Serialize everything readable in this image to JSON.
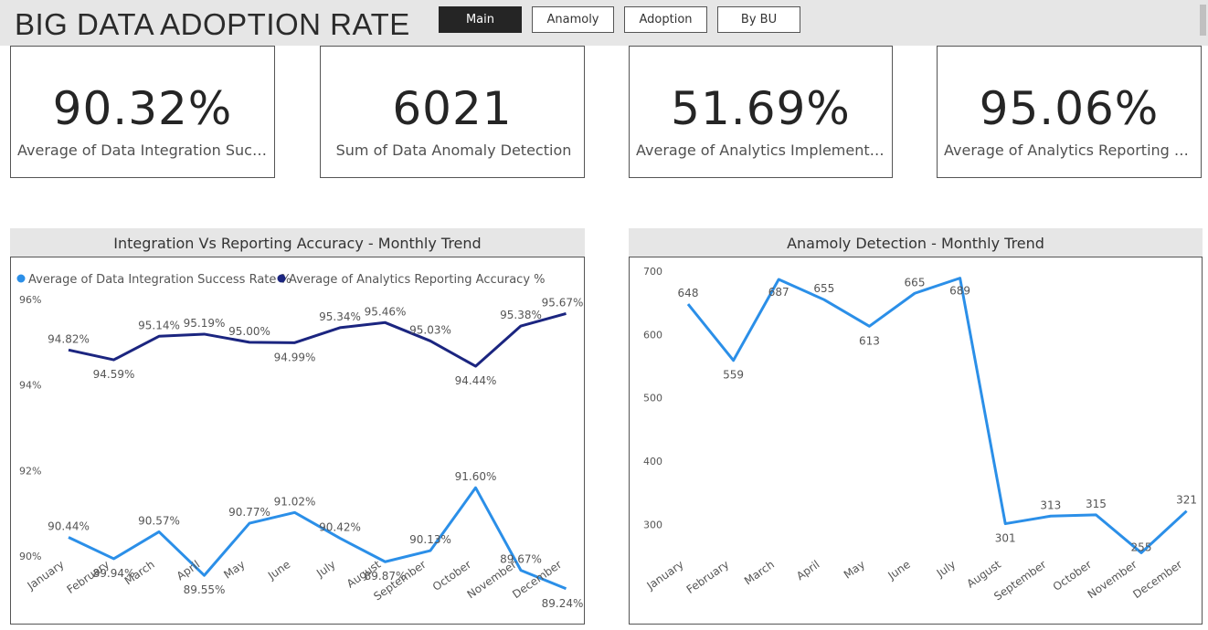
{
  "header": {
    "title": "BIG DATA ADOPTION RATE",
    "nav": [
      {
        "label": "Main",
        "active": true
      },
      {
        "label": "Anamoly",
        "active": false
      },
      {
        "label": "Adoption",
        "active": false
      },
      {
        "label": "By BU",
        "active": false
      }
    ]
  },
  "kpis": [
    {
      "value": "90.32%",
      "label": "Average of Data Integration Success..."
    },
    {
      "value": "6021",
      "label": "Sum of Data Anomaly Detection"
    },
    {
      "value": "51.69%",
      "label": "Average of Analytics Implementatio..."
    },
    {
      "value": "95.06%",
      "label": "Average of Analytics Reporting Accu..."
    }
  ],
  "colors": {
    "light_series": "#2b8fe8",
    "dark_series": "#1b2580",
    "anomaly_line": "#2b8fe8"
  },
  "chart_data": [
    {
      "type": "line",
      "title": "Integration Vs Reporting Accuracy - Monthly Trend",
      "categories": [
        "January",
        "February",
        "March",
        "April",
        "May",
        "June",
        "July",
        "August",
        "September",
        "October",
        "November",
        "December"
      ],
      "series": [
        {
          "name": "Average of Data Integration Success Rate %",
          "values": [
            90.44,
            89.94,
            90.57,
            89.55,
            90.77,
            91.02,
            90.42,
            89.87,
            90.13,
            91.6,
            89.67,
            89.24
          ],
          "labels": [
            "90.44%",
            "89.94%",
            "90.57%",
            "89.55%",
            "90.77%",
            "91.02%",
            "90.42%",
            "89.87%",
            "90.13%",
            "91.60%",
            "89.67%",
            "89.24%"
          ]
        },
        {
          "name": "Average of Analytics Reporting Accuracy %",
          "values": [
            94.82,
            94.59,
            95.14,
            95.19,
            95.0,
            94.99,
            95.34,
            95.46,
            95.03,
            94.44,
            95.38,
            95.67
          ],
          "labels": [
            "94.82%",
            "94.59%",
            "95.14%",
            "95.19%",
            "95.00%",
            "94.99%",
            "95.34%",
            "95.46%",
            "95.03%",
            "94.44%",
            "95.38%",
            "95.67%"
          ]
        }
      ],
      "ylim": [
        89,
        96
      ],
      "yticks": [
        90,
        92,
        94,
        96
      ],
      "ytick_labels": [
        "90%",
        "92%",
        "94%",
        "96%"
      ],
      "legend": "top-left"
    },
    {
      "type": "line",
      "title": "Anamoly Detection - Monthly Trend",
      "categories": [
        "January",
        "February",
        "March",
        "April",
        "May",
        "June",
        "July",
        "August",
        "September",
        "October",
        "November",
        "December"
      ],
      "series": [
        {
          "values": [
            648,
            559,
            687,
            655,
            613,
            665,
            689,
            301,
            313,
            315,
            255,
            321
          ],
          "labels": [
            "648",
            "559",
            "687",
            "655",
            "613",
            "665",
            "689",
            "301",
            "313",
            "315",
            "255",
            "321"
          ]
        }
      ],
      "ylim": [
        247,
        700
      ],
      "yticks": [
        300,
        400,
        500,
        600,
        700
      ],
      "ytick_labels": [
        "300",
        "400",
        "500",
        "600",
        "700"
      ]
    }
  ]
}
